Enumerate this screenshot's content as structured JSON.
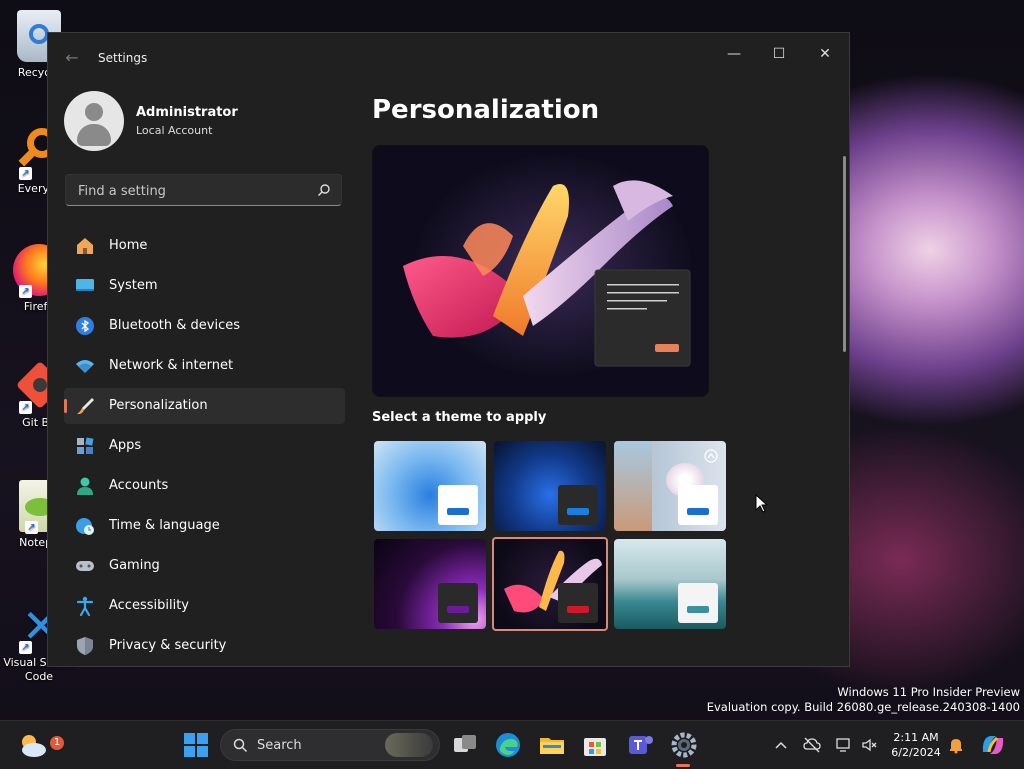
{
  "desktop": {
    "icons": [
      {
        "label": "Recycle",
        "icon": "recycle-bin-icon"
      },
      {
        "label": "Everyth",
        "icon": "everything-search-icon"
      },
      {
        "label": "Firefo",
        "icon": "firefox-icon"
      },
      {
        "label": "Git Ba",
        "icon": "git-bash-icon"
      },
      {
        "label": "Notepa",
        "icon": "notepad-plus-plus-icon"
      },
      {
        "label": "Visual Studio Code",
        "icon": "vscode-icon"
      }
    ],
    "watermark_line1": "Windows 11 Pro Insider Preview",
    "watermark_line2": "Evaluation copy. Build 26080.ge_release.240308-1400"
  },
  "window": {
    "title": "Settings",
    "controls": {
      "minimize": "—",
      "maximize": "☐",
      "close": "✕"
    }
  },
  "profile": {
    "name": "Administrator",
    "account_type": "Local Account"
  },
  "search": {
    "placeholder": "Find a setting"
  },
  "nav": {
    "items": [
      {
        "label": "Home",
        "icon": "home-icon"
      },
      {
        "label": "System",
        "icon": "system-icon"
      },
      {
        "label": "Bluetooth & devices",
        "icon": "bluetooth-icon"
      },
      {
        "label": "Network & internet",
        "icon": "wifi-icon"
      },
      {
        "label": "Personalization",
        "icon": "brush-icon",
        "active": true
      },
      {
        "label": "Apps",
        "icon": "apps-icon"
      },
      {
        "label": "Accounts",
        "icon": "accounts-icon"
      },
      {
        "label": "Time & language",
        "icon": "globe-clock-icon"
      },
      {
        "label": "Gaming",
        "icon": "gamepad-icon"
      },
      {
        "label": "Accessibility",
        "icon": "accessibility-icon"
      },
      {
        "label": "Privacy & security",
        "icon": "shield-icon"
      }
    ]
  },
  "main": {
    "title": "Personalization",
    "theme_section_title": "Select a theme to apply",
    "themes": [
      {
        "name": "windows-light",
        "selected": false
      },
      {
        "name": "windows-dark",
        "selected": false
      },
      {
        "name": "windows-spotlight",
        "selected": false
      },
      {
        "name": "glow",
        "selected": false
      },
      {
        "name": "captured-motion",
        "selected": true
      },
      {
        "name": "flow",
        "selected": false
      }
    ]
  },
  "taskbar": {
    "search_label": "Search",
    "weather_badge": "1",
    "time": "2:11 AM",
    "date": "6/2/2024"
  },
  "colors": {
    "accent": "#e3765a",
    "window_bg": "#202020",
    "taskbar_bg": "#1f1f22"
  }
}
